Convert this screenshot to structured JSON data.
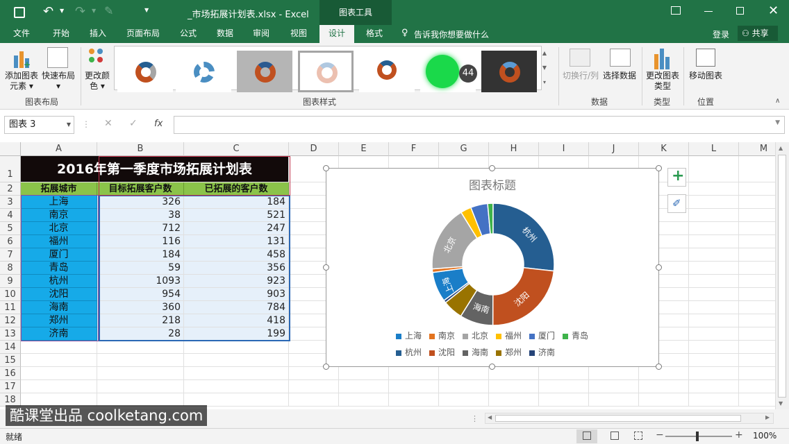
{
  "titlebar": {
    "filename": "_市场拓展计划表.xlsx - Excel",
    "context_tab": "图表工具"
  },
  "tabs": [
    "文件",
    "开始",
    "插入",
    "页面布局",
    "公式",
    "数据",
    "审阅",
    "视图",
    "设计",
    "格式"
  ],
  "tell_me": "告诉我你想要做什么",
  "login": "登录",
  "share": "共享",
  "ribbon": {
    "add_element": "添加图表元素",
    "quick_layout": "快速布局",
    "change_color": "更改颜色",
    "group_layout": "图表布局",
    "group_styles": "图表样式",
    "switch_rowcol": "切换行/列",
    "select_data": "选择数据",
    "group_data": "数据",
    "change_type": "更改图表类型",
    "group_type": "类型",
    "move_chart": "移动图表",
    "group_location": "位置"
  },
  "namebox": "图表 3",
  "fx": "fx",
  "columns": [
    "A",
    "B",
    "C",
    "D",
    "E",
    "F",
    "G",
    "H",
    "I",
    "J",
    "K",
    "L",
    "M"
  ],
  "rows": [
    "1",
    "2",
    "3",
    "4",
    "5",
    "6",
    "7",
    "8",
    "9",
    "10",
    "11",
    "12",
    "13",
    "14",
    "15",
    "16",
    "17",
    "18"
  ],
  "sheet": {
    "title": "2016年第一季度市场拓展计划表",
    "headers": [
      "拓展城市",
      "目标拓展客户数",
      "已拓展的客户数"
    ],
    "data": [
      [
        "上海",
        "326",
        "184"
      ],
      [
        "南京",
        "38",
        "521"
      ],
      [
        "北京",
        "712",
        "247"
      ],
      [
        "福州",
        "116",
        "131"
      ],
      [
        "厦门",
        "184",
        "458"
      ],
      [
        "青岛",
        "59",
        "356"
      ],
      [
        "杭州",
        "1093",
        "923"
      ],
      [
        "沈阳",
        "954",
        "903"
      ],
      [
        "海南",
        "360",
        "784"
      ],
      [
        "郑州",
        "218",
        "418"
      ],
      [
        "济南",
        "28",
        "199"
      ]
    ]
  },
  "chart_data": {
    "type": "pie",
    "title": "图表标题",
    "categories": [
      "上海",
      "南京",
      "北京",
      "福州",
      "厦门",
      "青岛",
      "杭州",
      "沈阳",
      "海南",
      "郑州",
      "济南"
    ],
    "values": [
      326,
      38,
      712,
      116,
      184,
      59,
      1093,
      954,
      360,
      218,
      28
    ],
    "slice_labels": {
      "杭州": "杭州",
      "沈阳": "沈阳",
      "北京": "北京",
      "海南": "海南",
      "上海": "上海"
    },
    "colors": [
      "#1a7ec8",
      "#e3731f",
      "#a5a5a5",
      "#ffc000",
      "#4472c4",
      "#3eb34a",
      "#255e91",
      "#c0501f",
      "#636363",
      "#997300",
      "#264478"
    ],
    "legend": "bottom"
  },
  "watermark": "酷课堂出品 coolketang.com",
  "status": {
    "ready": "就绪",
    "zoom": "100%"
  }
}
